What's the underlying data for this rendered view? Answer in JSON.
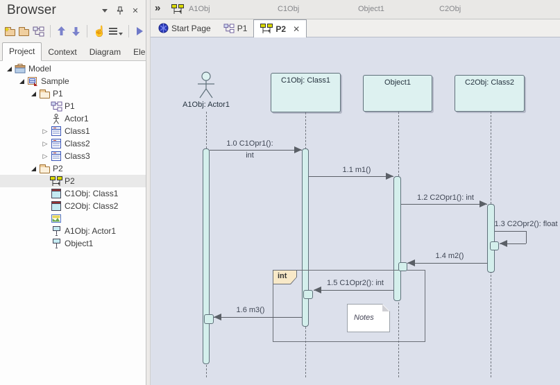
{
  "glyphs": {
    "close": "✕",
    "chevron_double": "»",
    "collapsed_arrow": "▷",
    "hand": "☝",
    "star": "✦"
  },
  "browser": {
    "title": "Browser",
    "toolbar_tabs": [
      "Project",
      "Context",
      "Diagram",
      "Element"
    ],
    "active_tab": "Project",
    "tree": [
      {
        "label": "Model",
        "icon": "model",
        "expanded": true,
        "depth": 0
      },
      {
        "label": "Sample",
        "icon": "view",
        "expanded": true,
        "depth": 1
      },
      {
        "label": "P1",
        "icon": "folder",
        "expanded": true,
        "depth": 2
      },
      {
        "label": "P1",
        "icon": "class-diagram",
        "depth": 3
      },
      {
        "label": "Actor1",
        "icon": "actor",
        "depth": 3
      },
      {
        "label": "Class1",
        "icon": "class",
        "collapsed": true,
        "depth": 3
      },
      {
        "label": "Class2",
        "icon": "class",
        "collapsed": true,
        "depth": 3
      },
      {
        "label": "Class3",
        "icon": "class",
        "collapsed": true,
        "depth": 3
      },
      {
        "label": "P2",
        "icon": "folder",
        "expanded": true,
        "depth": 2
      },
      {
        "label": "P2",
        "icon": "sequence-diagram",
        "selected": true,
        "depth": 3
      },
      {
        "label": "C1Obj: Class1",
        "icon": "object",
        "depth": 3
      },
      {
        "label": "C2Obj: Class2",
        "icon": "object",
        "depth": 3
      },
      {
        "label": "",
        "icon": "image",
        "depth": 3
      },
      {
        "label": "A1Obj: Actor1",
        "icon": "lifeline",
        "depth": 3
      },
      {
        "label": "Object1",
        "icon": "lifeline",
        "depth": 3
      }
    ]
  },
  "seq_header": {
    "labels": [
      "A1Obj",
      "C1Obj",
      "Object1",
      "C2Obj"
    ]
  },
  "doc_tabs": {
    "start_page": "Start Page",
    "p1": "P1",
    "p2": "P2",
    "active": "P2"
  },
  "diagram": {
    "lifelines": [
      {
        "name": "A1Obj: Actor1",
        "kind": "actor"
      },
      {
        "name": "C1Obj: Class1",
        "kind": "object"
      },
      {
        "name": "Object1",
        "kind": "object"
      },
      {
        "name": "C2Obj: Class2",
        "kind": "object"
      }
    ],
    "messages": [
      {
        "label": "1.0 C1Opr1():",
        "label2": "int",
        "from": "A1Obj: Actor1",
        "to": "C1Obj: Class1"
      },
      {
        "label": "1.1 m1()",
        "from": "C1Obj: Class1",
        "to": "Object1"
      },
      {
        "label": "1.2 C2Opr1(): int",
        "from": "Object1",
        "to": "C2Obj: Class2"
      },
      {
        "label": "1.3 C2Opr2(): float",
        "from": "C2Obj: Class2",
        "to": "C2Obj: Class2",
        "self": true
      },
      {
        "label": "1.4 m2()",
        "from": "C2Obj: Class2",
        "to": "Object1"
      },
      {
        "label": "1.5 C1Opr2(): int",
        "from": "Object1",
        "to": "C1Obj: Class1"
      },
      {
        "label": "1.6 m3()",
        "from": "C1Obj: Class1",
        "to": "A1Obj: Actor1"
      }
    ],
    "fragment": {
      "label": "int"
    },
    "note": {
      "text": "Notes"
    }
  },
  "colors": {
    "canvas_bg": "#dce0eb",
    "element_fill": "#ddf1f0",
    "element_border": "#5f707a",
    "selection_bg": "#e9e9e9",
    "toolbar_accent": "#7b82cc",
    "seq_icon_yellow": "#d8d800",
    "fragment_tag_fill": "#f8e9c8"
  }
}
